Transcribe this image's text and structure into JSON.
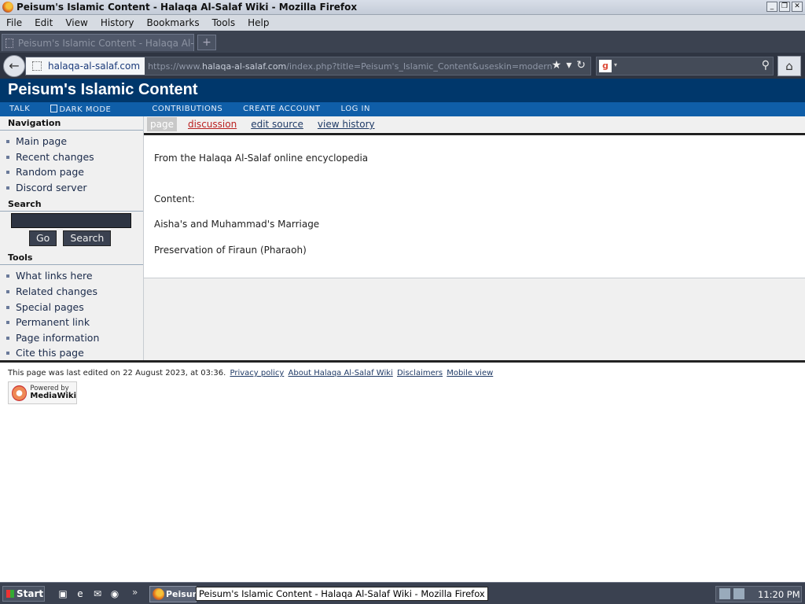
{
  "window": {
    "title": "Peisum's Islamic Content - Halaqa Al-Salaf Wiki - Mozilla Firefox",
    "controls": [
      "_",
      "❐",
      "✕"
    ]
  },
  "menubar": [
    "File",
    "Edit",
    "View",
    "History",
    "Bookmarks",
    "Tools",
    "Help"
  ],
  "tab": {
    "label": "Peisum's Islamic Content - Halaqa Al-Salaf Wiki",
    "newtab": "+"
  },
  "navbar": {
    "identity_domain": "halaqa-al-salaf.com",
    "url_prefix": "https://www.",
    "url_host": "halaqa-al-salaf.com",
    "url_rest": "/index.php?title=Peisum's_Islamic_Content&useskin=modern"
  },
  "wiki": {
    "sitename": "Peisum's Islamic Content",
    "personal": [
      "TALK",
      "DARK MODE",
      "CONTRIBUTIONS",
      "CREATE ACCOUNT",
      "LOG IN"
    ],
    "content_tabs": [
      "page",
      "discussion",
      "edit source",
      "view history"
    ]
  },
  "sidebar": {
    "navigation": {
      "heading": "Navigation",
      "items": [
        "Main page",
        "Recent changes",
        "Random page",
        "Discord server"
      ]
    },
    "search": {
      "heading": "Search",
      "go": "Go",
      "search": "Search"
    },
    "tools": {
      "heading": "Tools",
      "items": [
        "What links here",
        "Related changes",
        "Special pages",
        "Permanent link",
        "Page information",
        "Cite this page"
      ]
    }
  },
  "content": {
    "site_sub": "From the Halaqa Al-Salaf online encyclopedia",
    "label": "Content:",
    "links": [
      "Aisha's and Muhammad's Marriage",
      "Preservation of Firaun (Pharaoh)"
    ]
  },
  "footer": {
    "last_edited": "This page was last edited on 22 August 2023, at 03:36.",
    "links": [
      "Privacy policy",
      "About Halaqa Al-Salaf Wiki",
      "Disclaimers",
      "Mobile view"
    ],
    "powered_line1": "Powered by",
    "powered_line2": "MediaWiki"
  },
  "taskbar": {
    "start": "Start",
    "task_label": "Peisum",
    "tooltip": "Peisum's Islamic Content - Halaqa Al-Salaf Wiki - Mozilla Firefox",
    "clock": "11:20 PM"
  }
}
